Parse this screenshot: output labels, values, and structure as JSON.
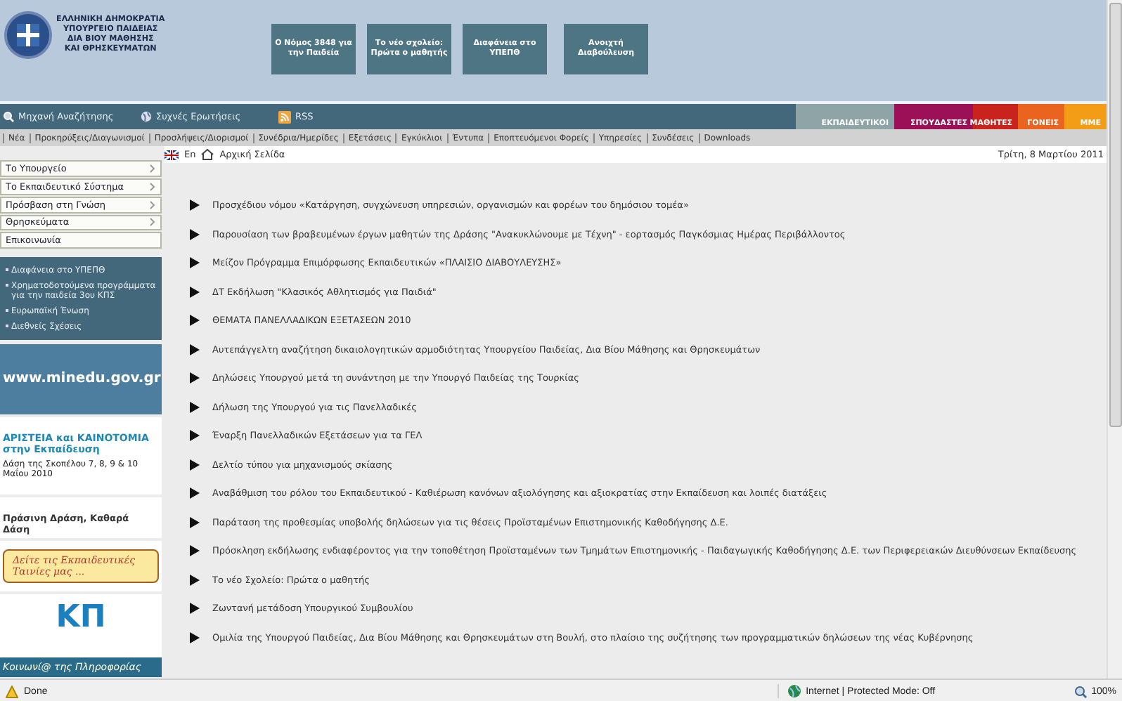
{
  "header": {
    "logo_lines": [
      "ΕΛΛΗΝΙΚΗ ΔΗΜΟΚΡΑΤΙΑ",
      "ΥΠΟΥΡΓΕΙΟ ΠΑΙΔΕΙΑΣ",
      "ΔΙΑ ΒΙΟΥ ΜΑΘΗΣΗΣ",
      "ΚΑΙ ΘΡΗΣΚΕΥΜΑΤΩΝ"
    ],
    "buttons": [
      "Ο Νόμος 3848 για την Παιδεία",
      "Το νέο σχολείο: Πρώτα ο μαθητής",
      "Διαφάνεια στο ΥΠΕΠΘ",
      "Ανοιχτή Διαβούλευση"
    ]
  },
  "toolbar": {
    "links": [
      {
        "kind": "search",
        "label": "Μηχανή Αναζήτησης"
      },
      {
        "kind": "faq",
        "label": "Συχνές Ερωτήσεις"
      },
      {
        "kind": "rss",
        "label": "RSS"
      }
    ],
    "audience_tabs": [
      {
        "label": "ΕΚΠΑΙΔΕΥΤΙΚΟΙ",
        "color": "#8fa4a7"
      },
      {
        "label": "ΣΠΟΥΔΑΣΤΕΣ",
        "color": "#9c1058"
      },
      {
        "label": "ΜΑΘΗΤΕΣ",
        "color": "#c8231c"
      },
      {
        "label": "ΓΟΝΕΙΣ",
        "color": "#ea6420"
      },
      {
        "label": "ΜΜΕ",
        "color": "#f39c16"
      }
    ]
  },
  "nav_links": [
    "Νέα",
    "Προκηρύξεις/Διαγωνισμοί",
    "Προσλήψεις/Διορισμοί",
    "Συνέδρια/Ημερίδες",
    "Εξετάσεις",
    "Εγκύκλιοι",
    "Έντυπα",
    "Εποπτευόμενοι Φορείς",
    "Υπηρεσίες",
    "Συνδέσεις",
    "Downloads"
  ],
  "breadcrumb": {
    "language": "En",
    "home": "Αρχική Σελίδα",
    "date": "Τρίτη, 8 Μαρτίου 2011"
  },
  "sidebar": {
    "menu": [
      {
        "label": "Το Υπουργείο",
        "submenu": true
      },
      {
        "label": "Το Εκπαιδευτικό Σύστημα",
        "submenu": true
      },
      {
        "label": "Πρόσβαση στη Γνώση",
        "submenu": true
      },
      {
        "label": "Θρησκεύματα",
        "submenu": true
      },
      {
        "label": "Επικοινωνία",
        "submenu": false
      }
    ],
    "links": [
      "Διαφάνεια στο ΥΠΕΠΘ",
      "Χρηματοδοτούμενα προγράμματα για την παιδεία 3ου ΚΠΣ",
      "Ευρωπαϊκή Ένωση",
      "Διεθνείς Σχέσεις"
    ],
    "banners": [
      {
        "kind": "minedu",
        "title": "www.minedu.gov.gr"
      },
      {
        "kind": "aristeia",
        "title": "ΑΡΙΣΤΕΙΑ και ΚΑΙΝΟΤΟΜΙΑ στην Εκπαίδευση",
        "subtitle": "Δάση της Σκοπέλου 7, 8, 9 & 10 Μαΐου 2010"
      },
      {
        "kind": "forest",
        "title": "Πράσινη Δράση, Καθαρά Δάση"
      },
      {
        "kind": "films",
        "title": "Δείτε τις Εκπαιδευτικές Ταινίες μας ..."
      },
      {
        "kind": "kp",
        "title": "ΚΠ",
        "subtitle": "Κοινωνί@ της Πληροφορίας"
      }
    ]
  },
  "news": [
    "Προσχέδιου νόμου «Κατάργηση, συγχώνευση υπηρεσιών, οργανισμών και φορέων του δημόσιου τομέα»",
    "Παρουσίαση των βραβευμένων έργων μαθητών της Δράσης \"Ανακυκλώνουμε με Τέχνη\" - εορτασμός Παγκόσμιας Ημέρας Περιβάλλοντος",
    "Μείζον Πρόγραμμα Επιμόρφωσης Εκπαιδευτικών «ΠΛΑΙΣΙΟ ΔΙΑΒΟΥΛΕΥΣΗΣ»",
    "ΔΤ Εκδήλωση \"Κλασικός Αθλητισμός για Παιδιά\"",
    "ΘΕΜΑΤΑ ΠΑΝΕΛΛΑΔΙΚΩΝ ΕΞΕΤΑΣΕΩΝ 2010",
    "Αυτεπάγγελτη αναζήτηση δικαιολογητικών αρμοδιότητας Υπουργείου Παιδείας, Δια Βίου Μάθησης και Θρησκευμάτων",
    "Δηλώσεις Υπουργού μετά τη συνάντηση με την Υπουργό Παιδείας της Τουρκίας",
    "Δήλωση της Υπουργού για τις Πανελλαδικές",
    "Έναρξη Πανελλαδικών Εξετάσεων για τα ΓΕΛ",
    "Δελτίο τύπου για μηχανισμούς σκίασης",
    "Αναβάθμιση του ρόλου του Εκπαιδευτικού - Καθιέρωση κανόνων αξιολόγησης και αξιοκρατίας στην Εκπαίδευση και λοιπές διατάξεις",
    "Παράταση της προθεσμίας υποβολής δηλώσεων για τις θέσεις Προϊσταμένων Επιστημονικής Καθοδήγησης Δ.Ε.",
    "Πρόσκληση εκδήλωσης ενδιαφέροντος για την τοποθέτηση Προϊσταμένων των Τμημάτων Επιστημονικής - Παιδαγωγικής Καθοδήγησης Δ.Ε. των Περιφερειακών Διευθύνσεων Εκπαίδευσης",
    "Το νέο Σχολείο: Πρώτα ο μαθητής",
    "Ζωντανή μετάδοση Υπουργικού Συμβουλίου",
    "Ομιλία της Υπουργού Παιδείας, Δια Βίου Μάθησης και Θρησκευμάτων στη Βουλή, στο πλαίσιο της συζήτησης των προγραμματικών δηλώσεων της νέας Κυβέρνησης"
  ],
  "status_bar": {
    "status": "Done",
    "zone": "Internet | Protected Mode: Off",
    "zoom": "100%"
  }
}
